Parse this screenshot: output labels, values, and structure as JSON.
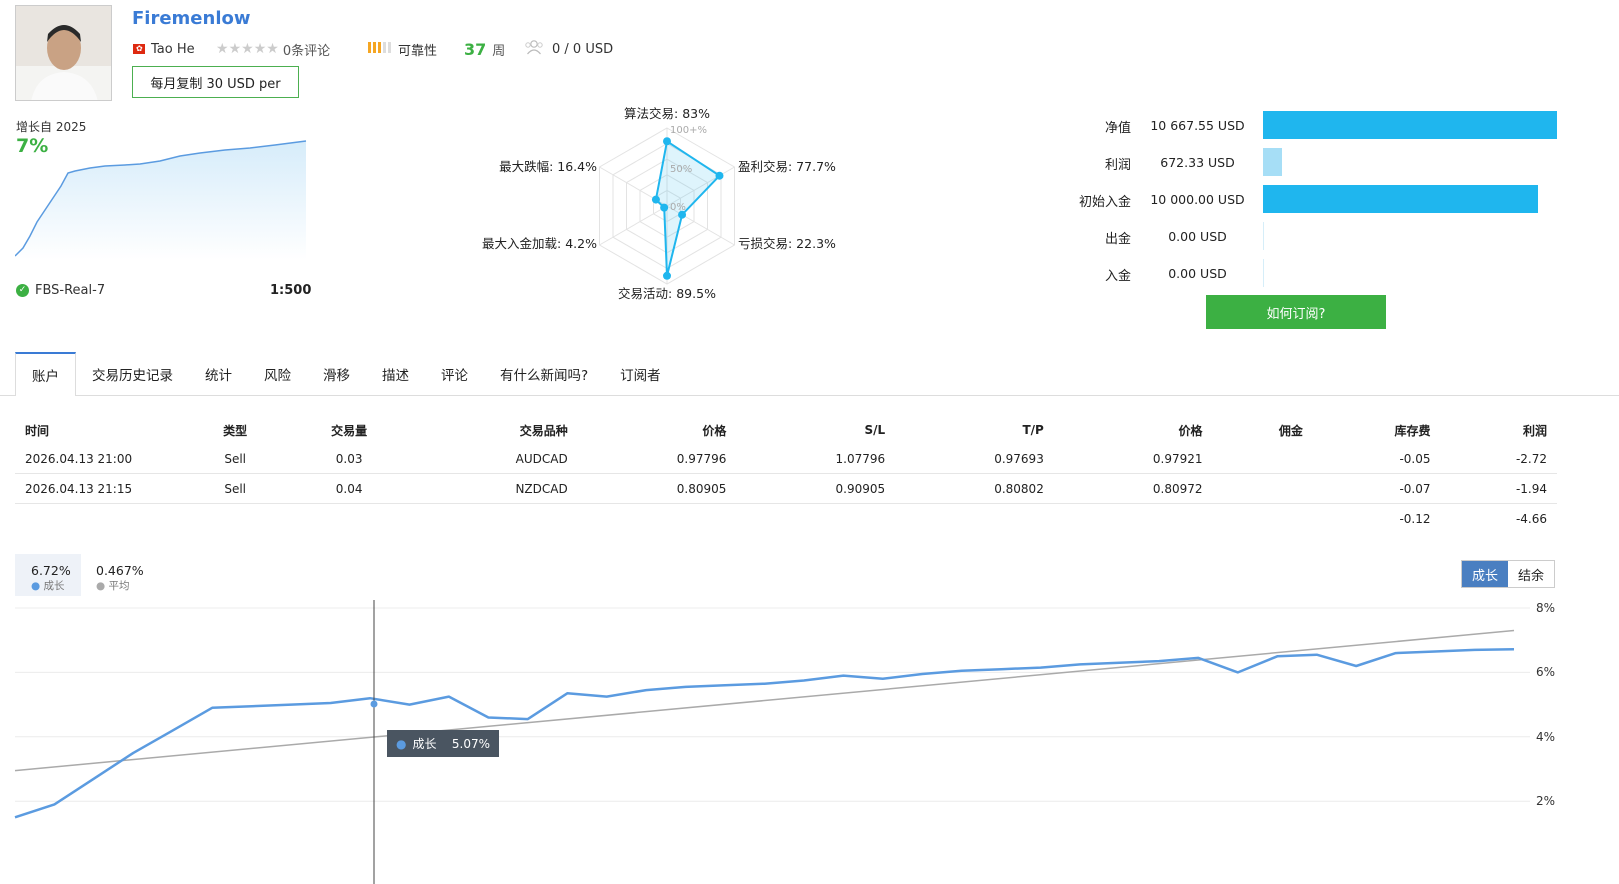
{
  "provider": {
    "name": "Firemenlow",
    "author": "Tao He",
    "reviews": "0条评论",
    "reliability_label": "可靠性",
    "weeks_value": "37",
    "weeks_unit": "周",
    "subscribers": "0 / 0 USD",
    "copy_button": "每月复制 30 USD per",
    "rating_stars": 0
  },
  "growth_summary": {
    "label": "增长自 2025",
    "value": "7%",
    "broker": "FBS-Real-7",
    "leverage": "1:500"
  },
  "radar": {
    "labels": {
      "algo": "算法交易: 83%",
      "profit_trades": "盈利交易: 77.7%",
      "loss_trades": "亏损交易: 22.3%",
      "activity": "交易活动: 89.5%",
      "max_deposit_load": "最大入金加载: 4.2%",
      "max_drawdown": "最大跌幅: 16.4%"
    },
    "scale": {
      "top": "100+%",
      "mid": "50%",
      "low": "0%"
    },
    "values": [
      83,
      77.7,
      22.3,
      89.5,
      4.2,
      16.4
    ]
  },
  "account_stats": [
    {
      "label": "净值",
      "value": "10 667.55 USD",
      "fraction": 1.0
    },
    {
      "label": "利润",
      "value": "672.33 USD",
      "fraction": 0.063
    },
    {
      "label": "初始入金",
      "value": "10 000.00 USD",
      "fraction": 0.937
    },
    {
      "label": "出金",
      "value": "0.00 USD",
      "fraction": 0
    },
    {
      "label": "入金",
      "value": "0.00 USD",
      "fraction": 0
    }
  ],
  "subscribe_button": "如何订阅?",
  "tabs": [
    "账户",
    "交易历史记录",
    "统计",
    "风险",
    "滑移",
    "描述",
    "评论",
    "有什么新闻吗?",
    "订阅者"
  ],
  "table": {
    "headers": [
      "时间",
      "类型",
      "交易量",
      "交易品种",
      "价格",
      "S/L",
      "T/P",
      "价格",
      "佣金",
      "库存费",
      "利润"
    ],
    "rows": [
      [
        "2026.04.13 21:00",
        "Sell",
        "0.03",
        "AUDCAD",
        "0.97796",
        "1.07796",
        "0.97693",
        "0.97921",
        "",
        "-0.05",
        "-2.72"
      ],
      [
        "2026.04.13 21:15",
        "Sell",
        "0.04",
        "NZDCAD",
        "0.80905",
        "0.90905",
        "0.80802",
        "0.80972",
        "",
        "-0.07",
        "-1.94"
      ]
    ],
    "totals": {
      "swap": "-0.12",
      "profit": "-4.66"
    }
  },
  "chart_legend": {
    "growth_value": "6.72%",
    "growth_label": "成长",
    "avg_value": "0.467%",
    "avg_label": "平均"
  },
  "chart_toggle": {
    "growth": "成长",
    "balance": "结余"
  },
  "tooltip": {
    "label": "成长",
    "value": "5.07%"
  },
  "colors": {
    "accent": "#3a7bd5",
    "green": "#3cb043",
    "bar": "#1fb6ee",
    "line": "#5b9be0",
    "neg": "#d9282f"
  },
  "chart_data": {
    "type": "line",
    "title": "",
    "ylabel": "",
    "y_ticks": [
      "8%",
      "6%",
      "4%",
      "2%"
    ],
    "ylim": [
      1.5,
      8
    ],
    "series": [
      {
        "name": "成长",
        "values": [
          1.5,
          1.9,
          2.7,
          3.5,
          4.2,
          4.9,
          4.95,
          5.0,
          5.05,
          5.2,
          5.0,
          5.25,
          4.6,
          4.55,
          5.35,
          5.25,
          5.45,
          5.55,
          5.6,
          5.65,
          5.75,
          5.9,
          5.8,
          5.95,
          6.05,
          6.1,
          6.15,
          6.25,
          6.3,
          6.35,
          6.45,
          6.0,
          6.5,
          6.55,
          6.2,
          6.6,
          6.65,
          6.7,
          6.72
        ]
      },
      {
        "name": "平均",
        "values": [
          2.95,
          7.3
        ]
      }
    ]
  }
}
